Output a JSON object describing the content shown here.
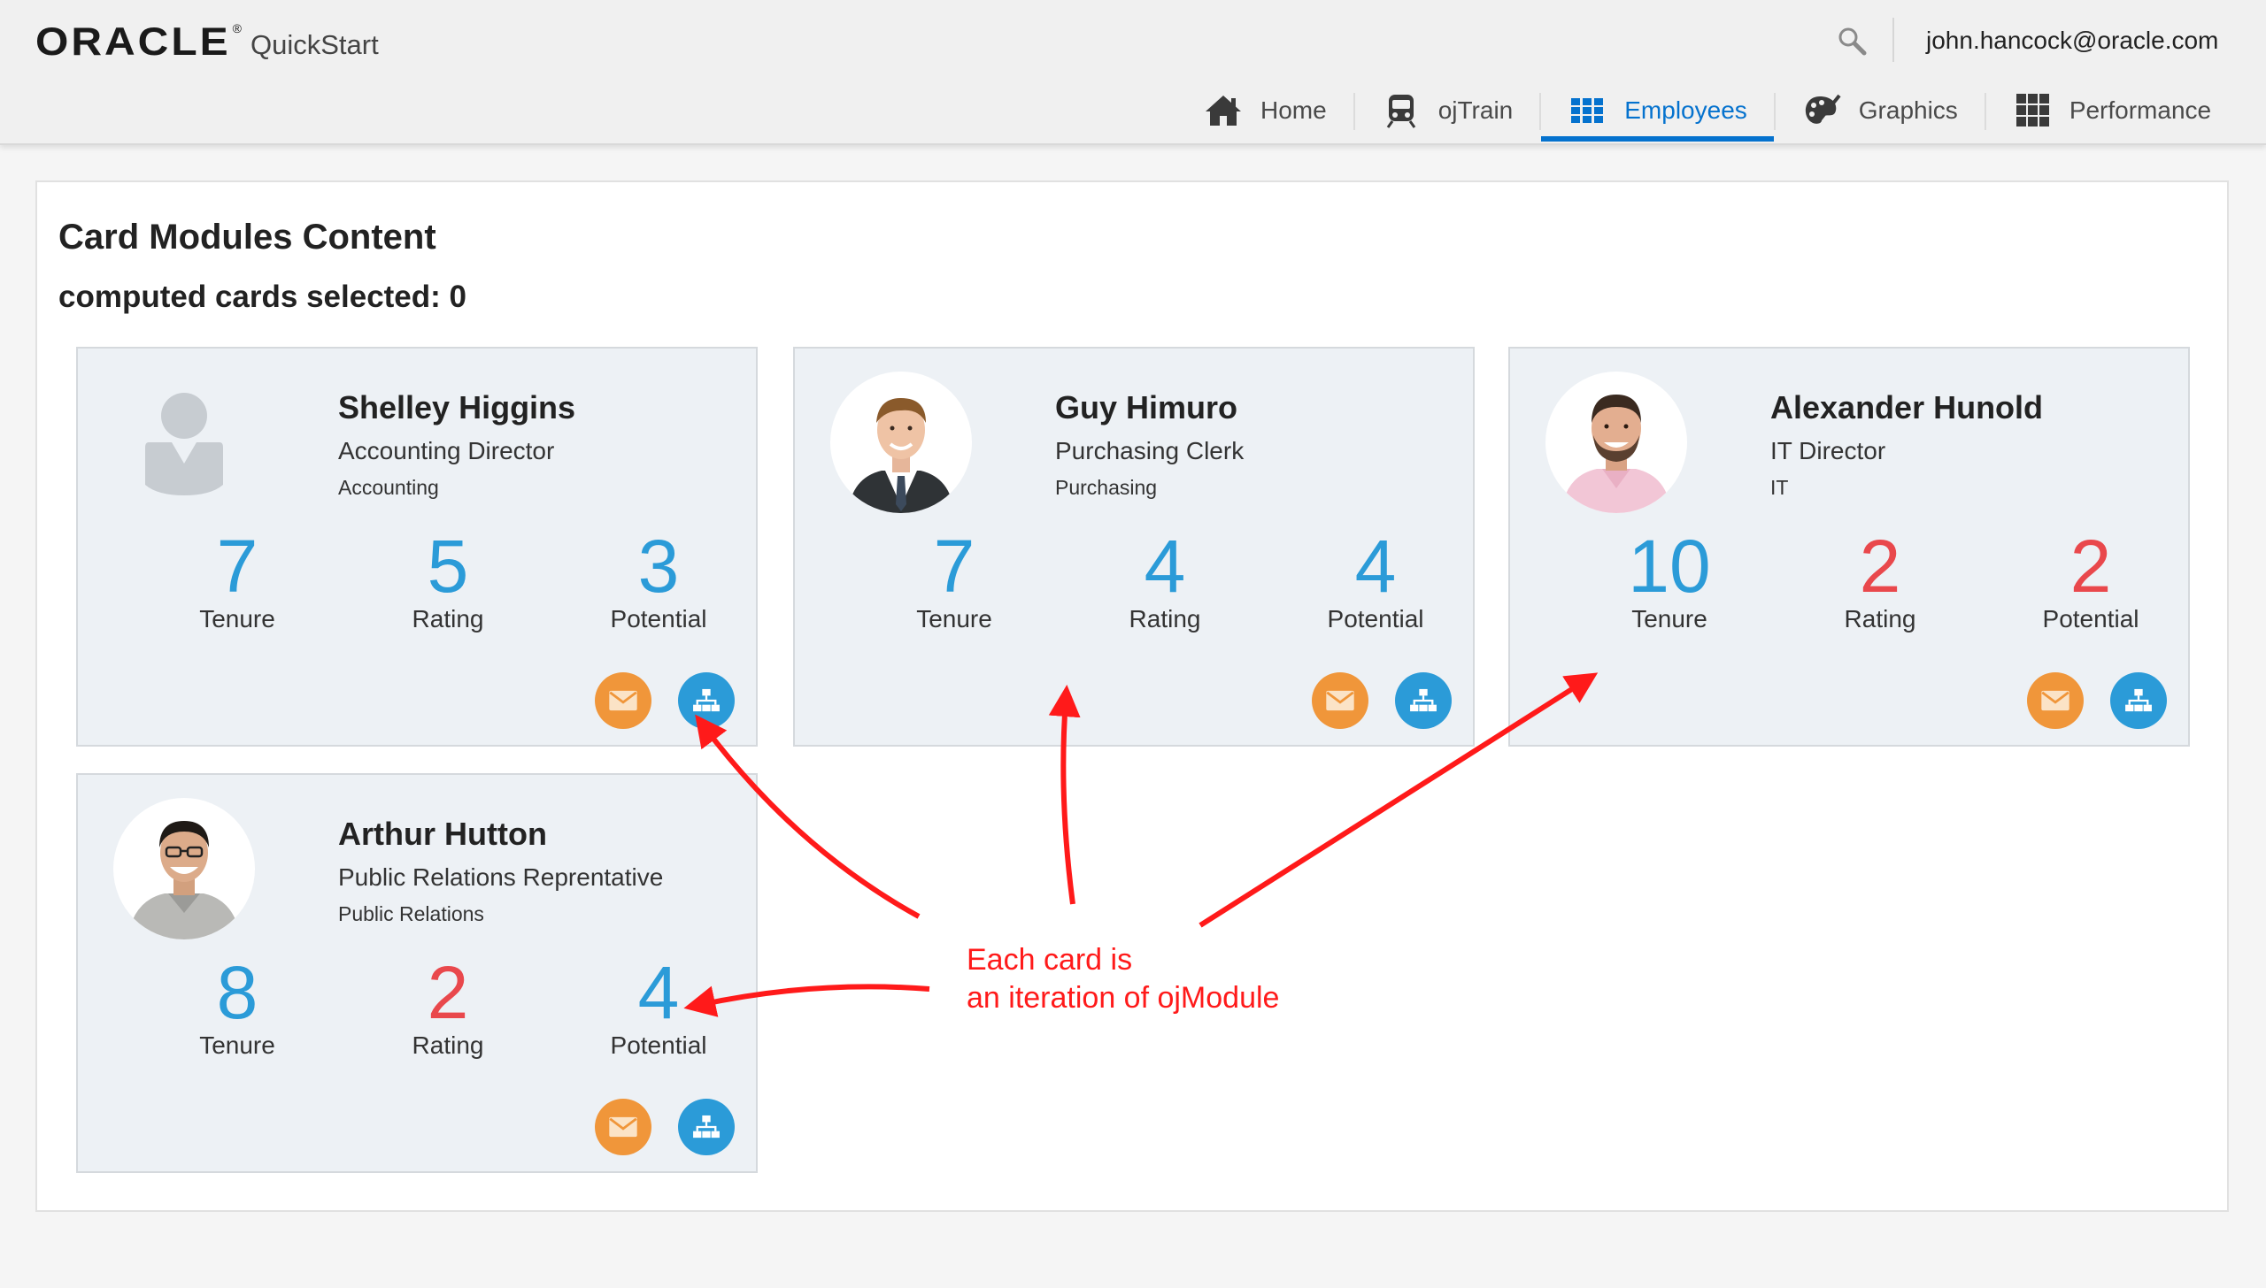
{
  "header": {
    "brand": "ORACLE",
    "brand_mark": "®",
    "app_name": "QuickStart",
    "search_icon": "search-icon",
    "user_email": "john.hancock@oracle.com"
  },
  "nav": [
    {
      "label": "Home",
      "icon": "home-icon",
      "active": false
    },
    {
      "label": "ojTrain",
      "icon": "train-icon",
      "active": false
    },
    {
      "label": "Employees",
      "icon": "grid-icon",
      "active": true
    },
    {
      "label": "Graphics",
      "icon": "palette-icon",
      "active": false
    },
    {
      "label": "Performance",
      "icon": "dashboard-grid-icon",
      "active": false
    }
  ],
  "panel": {
    "title": "Card Modules Content",
    "subtitle": "computed cards selected: 0"
  },
  "employees": [
    {
      "name": "Shelley Higgins",
      "title": "Accounting Director",
      "department": "Accounting",
      "avatar": "placeholder-avatar",
      "metrics": [
        {
          "label": "Tenure",
          "value": "7",
          "status": "normal"
        },
        {
          "label": "Rating",
          "value": "5",
          "status": "normal"
        },
        {
          "label": "Potential",
          "value": "3",
          "status": "normal"
        }
      ]
    },
    {
      "name": "Guy Himuro",
      "title": "Purchasing Clerk",
      "department": "Purchasing",
      "avatar": "photo",
      "metrics": [
        {
          "label": "Tenure",
          "value": "7",
          "status": "normal"
        },
        {
          "label": "Rating",
          "value": "4",
          "status": "normal"
        },
        {
          "label": "Potential",
          "value": "4",
          "status": "normal"
        }
      ]
    },
    {
      "name": "Alexander Hunold",
      "title": "IT Director",
      "department": "IT",
      "avatar": "photo",
      "metrics": [
        {
          "label": "Tenure",
          "value": "10",
          "status": "normal"
        },
        {
          "label": "Rating",
          "value": "2",
          "status": "low"
        },
        {
          "label": "Potential",
          "value": "2",
          "status": "low"
        }
      ]
    },
    {
      "name": "Arthur Hutton",
      "title": "Public Relations Reprentative",
      "department": "Public Relations",
      "avatar": "photo",
      "metrics": [
        {
          "label": "Tenure",
          "value": "8",
          "status": "normal"
        },
        {
          "label": "Rating",
          "value": "2",
          "status": "low"
        },
        {
          "label": "Potential",
          "value": "4",
          "status": "normal"
        }
      ]
    }
  ],
  "card_actions": {
    "mail_icon": "mail-icon",
    "org_icon": "org-chart-icon"
  },
  "annotation": {
    "line1": "Each card is",
    "line2": "an iteration of ojModule"
  },
  "colors": {
    "accent": "#0572ce",
    "metric_normal": "#2b9bd8",
    "metric_low": "#e9484c",
    "mail_button": "#f0963a",
    "org_button": "#2b9bd8",
    "annotation": "#ff1a1a",
    "card_bg": "#edf1f5"
  }
}
